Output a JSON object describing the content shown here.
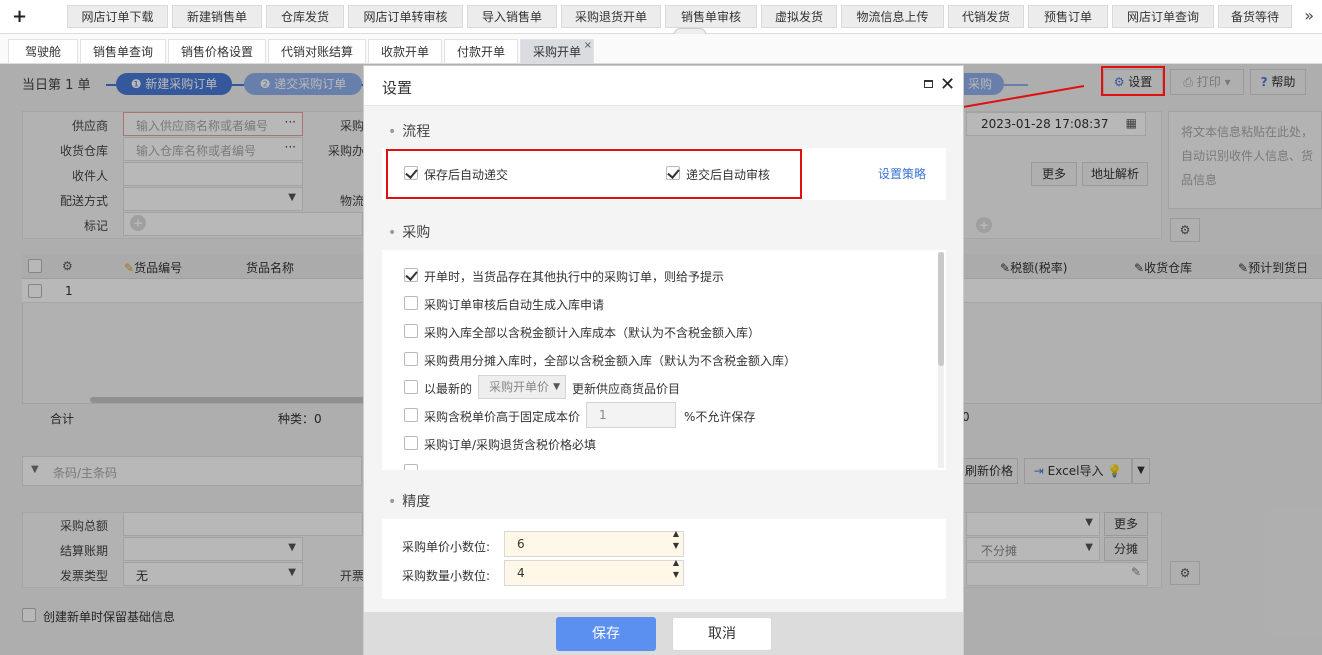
{
  "topnav": {
    "plus": "+",
    "tabs": [
      "网店订单下载",
      "新建销售单",
      "仓库发货",
      "网店订单转审核",
      "导入销售单",
      "采购退货开单",
      "销售单审核",
      "虚拟发货",
      "物流信息上传",
      "代销发货",
      "预售订单",
      "网店订单查询",
      "备货等待"
    ],
    "more": "»"
  },
  "subnav": {
    "tabs": [
      "驾驶舱",
      "销售单查询",
      "销售价格设置",
      "代销对账结算",
      "收款开单",
      "付款开单",
      "采购开单"
    ],
    "close": "×"
  },
  "page": {
    "day_order": "当日第 1 单",
    "step1": "❶ 新建采购订单",
    "step2": "❷ 递交采购订单",
    "step_last": "采购",
    "settings_btn": "设置",
    "print_btn": "打印",
    "help_btn": "帮助",
    "supplier_label": "供应商",
    "supplier_placeholder": "输入供应商名称或者编号",
    "warehouse_label": "收货仓库",
    "warehouse_placeholder": "输入仓库名称或者编号",
    "receiver_label": "收件人",
    "delivery_label": "配送方式",
    "tag_label": "标记",
    "purchase_label": "采购",
    "purchase_handler_label": "采购办",
    "logistics_label": "物流",
    "date_value": "2023-01-28 17:08:37",
    "paste_hint": "将文本信息粘贴在此处，自动识别收件人信息、货品信息",
    "more_btn": "更多",
    "parse_btn": "地址解析",
    "grid_headers": [
      "货品编号",
      "货品名称",
      "税额(税率)",
      "收货仓库",
      "预计到货日"
    ],
    "row_no": "1",
    "total_label": "合计",
    "kinds_label": "种类：0",
    "zero": "0",
    "barcode_placeholder": "条码/主条码",
    "refresh_price_btn": "刷新价格",
    "excel_import_btn": "Excel导入",
    "purchase_total_label": "采购总额",
    "settle_period_label": "结算账期",
    "invoice_type_label": "发票类型",
    "invoice_type_value": "无",
    "invoice_label": "开票",
    "no_split": "不分摊",
    "split_btn": "分摊",
    "keep_info": "创建新单时保留基础信息"
  },
  "dialog": {
    "title": "设置",
    "sections": {
      "flow": "流程",
      "purchase": "采购",
      "precision": "精度"
    },
    "flow_options": [
      {
        "label": "保存后自动递交",
        "checked": true
      },
      {
        "label": "递交后自动审核",
        "checked": true
      }
    ],
    "flow_link": "设置策略",
    "purchase_options": [
      {
        "label": "开单时，当货品存在其他执行中的采购订单，则给予提示",
        "checked": true
      },
      {
        "label": "采购订单审核后自动生成入库申请",
        "checked": false
      },
      {
        "label": "采购入库全部以含税金额计入库成本（默认为不含税金额入库）",
        "checked": false
      },
      {
        "label": "采购费用分摊入库时，全部以含税金额入库（默认为不含税金额入库）",
        "checked": false
      }
    ],
    "latest_prefix": "以最新的",
    "latest_select": "采购开单价",
    "latest_suffix": "更新供应商货品价目",
    "fixed_prefix": "采购含税单价高于固定成本价",
    "fixed_value": "1",
    "fixed_suffix": "%不允许保存",
    "required_option": "采购订单/采购退货含税价格必填",
    "price_decimals_label": "采购单价小数位:",
    "price_decimals_value": "6",
    "qty_decimals_label": "采购数量小数位:",
    "qty_decimals_value": "4",
    "save_btn": "保存",
    "cancel_btn": "取消"
  },
  "colors": {
    "accent": "#5b8ff0",
    "highlight": "#e01010",
    "step_blue": "#4a7ad8"
  }
}
